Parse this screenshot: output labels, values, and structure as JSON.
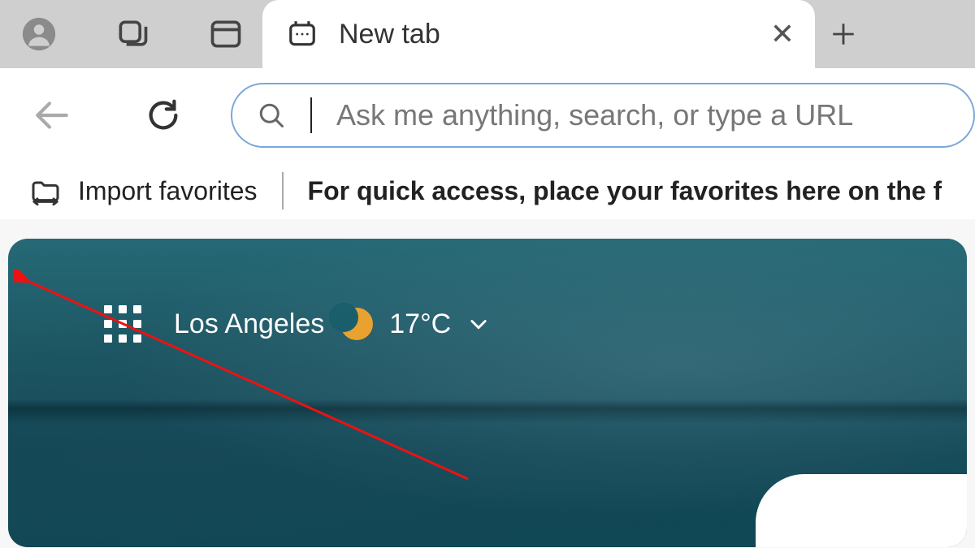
{
  "tabStrip": {
    "activeTab": {
      "title": "New tab"
    }
  },
  "toolbar": {
    "addressBar": {
      "placeholder": "Ask me anything, search, or type a URL",
      "value": ""
    }
  },
  "favoritesBar": {
    "importLabel": "Import favorites",
    "hint": "For quick access, place your favorites here on the f"
  },
  "ntp": {
    "city": "Los Angeles",
    "temperature": "17°C",
    "weatherIcon": "moon"
  }
}
